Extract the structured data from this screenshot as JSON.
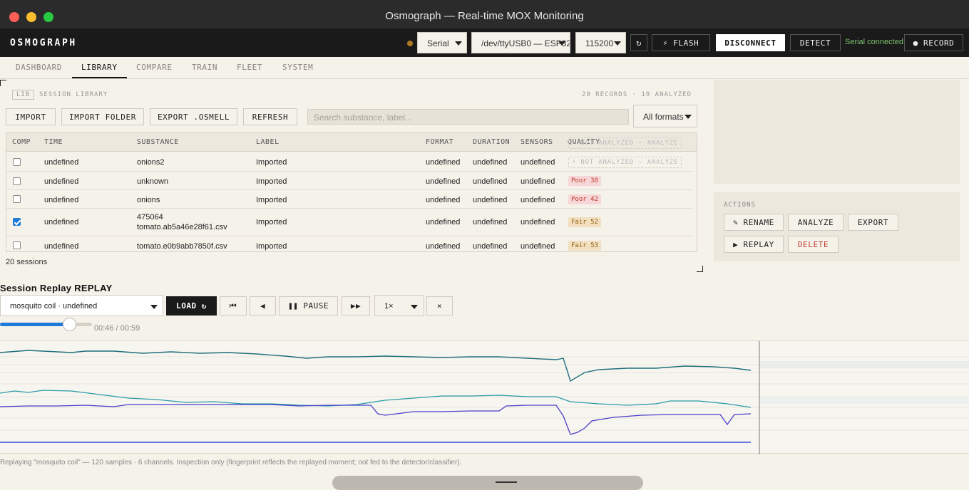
{
  "window": {
    "title": "Osmograph — Real-time MOX Monitoring"
  },
  "header": {
    "brand": "OSMOGRAPH",
    "transport": "Serial",
    "port": "/dev/ttyUSB0 — ESP32",
    "baud": "115200",
    "flash_label": "⚡ FLASH",
    "disconnect_label": "DISCONNECT",
    "detect_label": "DETECT",
    "status": "Serial connected",
    "record_label": "● RECORD",
    "status_color": "#7cc46b"
  },
  "nav": {
    "tabs": [
      "DASHBOARD",
      "LIBRARY",
      "COMPARE",
      "TRAIN",
      "FLEET",
      "SYSTEM"
    ],
    "active": "LIBRARY"
  },
  "library": {
    "tag": "LIB",
    "title": "SESSION LIBRARY",
    "counts": "20 RECORDS · 19 ANALYZED",
    "import_label": "IMPORT",
    "import_folder_label": "IMPORT FOLDER",
    "export_label": "EXPORT .OSMELL",
    "refresh_label": "REFRESH",
    "search_placeholder": "Search substance, label...",
    "format_filter": "All formats",
    "columns": [
      "COMP",
      "TIME",
      "SUBSTANCE",
      "LABEL",
      "FORMAT",
      "DURATION",
      "SENSORS",
      "QUALITY"
    ],
    "rows": [
      {
        "checked": false,
        "time": "undefined",
        "substance": "onions2",
        "label": "Imported",
        "format": "undefined",
        "duration": "undefined",
        "sensors": "undefined",
        "quality": "⚡ NOT ANALYZED — ANALYZE",
        "quality_kind": "na"
      },
      {
        "checked": false,
        "time": "undefined",
        "substance": "unknown",
        "label": "Imported",
        "format": "undefined",
        "duration": "undefined",
        "sensors": "undefined",
        "quality": "Poor 38",
        "quality_kind": "poor"
      },
      {
        "checked": false,
        "time": "undefined",
        "substance": "onions",
        "label": "Imported",
        "format": "undefined",
        "duration": "undefined",
        "sensors": "undefined",
        "quality": "Poor 42",
        "quality_kind": "poor"
      },
      {
        "checked": true,
        "time": "undefined",
        "substance": "475064",
        "substance2": "tomato.ab5a46e28f61.csv",
        "label": "Imported",
        "format": "undefined",
        "duration": "undefined",
        "sensors": "undefined",
        "quality": "Fair 52",
        "quality_kind": "fair"
      },
      {
        "checked": false,
        "time": "undefined",
        "substance": "tomato.e0b9abb7850f.csv",
        "label": "Imported",
        "format": "undefined",
        "duration": "undefined",
        "sensors": "undefined",
        "quality": "Fair 53",
        "quality_kind": "fair"
      }
    ],
    "header_badge": "⚡ NOT ANALYZED — ANALYZE",
    "session_count": "20 sessions"
  },
  "actions": {
    "label": "ACTIONS",
    "rename_label": "✎ RENAME",
    "analyze_label": "ANALYZE",
    "export_label": "EXPORT",
    "replay_label": "▶ REPLAY",
    "delete_label": "DELETE"
  },
  "replay": {
    "title": "Session Replay REPLAY",
    "session": "mosquito coil · undefined",
    "load_label": "LOAD ↻",
    "first_label": "⏮",
    "prev_label": "◀",
    "pause_label": "❚❚ PAUSE",
    "next_label": "▶▶",
    "speed": "1×",
    "close_label": "×",
    "progress": 0.78,
    "time": "00:46 / 00:59",
    "caption": "Replaying \"mosquito coil\" — 120 samples · 6 channels. Inspection only (fingerprint reflects the replayed moment; not fed to the detector/classifier)."
  },
  "colors": {
    "accent": "#1e7ad8",
    "poor": "#c0392b",
    "fair": "#946010"
  }
}
